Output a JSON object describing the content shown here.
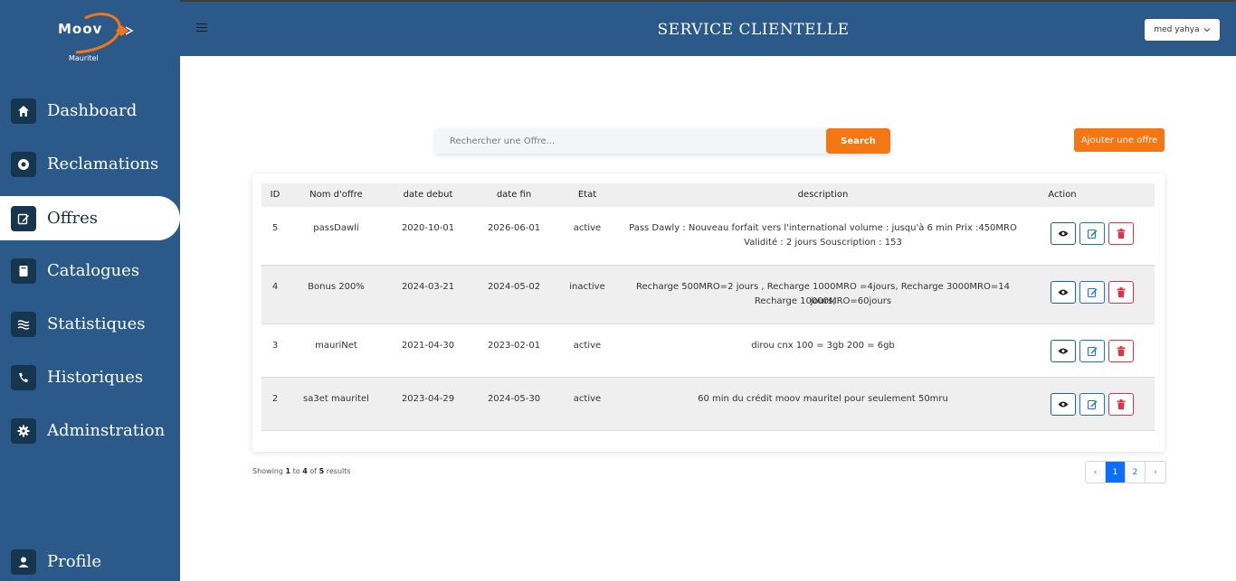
{
  "brand": {
    "name": "Moov",
    "sub": "Mauritel"
  },
  "sidebar": {
    "items": [
      {
        "label": "Dashboard",
        "icon": "home-icon"
      },
      {
        "label": "Reclamations",
        "icon": "circle-dot-icon"
      },
      {
        "label": "Offres",
        "icon": "edit-icon",
        "active": true
      },
      {
        "label": "Catalogues",
        "icon": "book-icon"
      },
      {
        "label": "Statistiques",
        "icon": "waves-icon"
      },
      {
        "label": "Historiques",
        "icon": "phone-icon"
      },
      {
        "label": "Adminstration",
        "icon": "gear-icon"
      }
    ],
    "profile": {
      "label": "Profile",
      "icon": "user-icon"
    }
  },
  "header": {
    "title": "SERVICE CLIENTELLE",
    "user": "med yahya"
  },
  "search": {
    "placeholder": "Rechercher une Offre...",
    "button": "Search"
  },
  "add_button": "Ajouter une offre",
  "table": {
    "headers": [
      "ID",
      "Nom d'offre",
      "date debut",
      "date fin",
      "Etat",
      "description",
      "Action"
    ],
    "rows": [
      {
        "id": "5",
        "name": "passDawli",
        "start": "2020-10-01",
        "end": "2026-06-01",
        "state": "active",
        "desc1": "Pass Dawly : Nouveau forfait vers l'international volume : jusqu'à 6 min Prix :450MRO",
        "desc2": "Validité : 2 jours Souscription : 153"
      },
      {
        "id": "4",
        "name": "Bonus 200%",
        "start": "2024-03-21",
        "end": "2024-05-02",
        "state": "inactive",
        "desc1": "Recharge 500MRO=2 jours , Recharge 1000MRO =4jours, Recharge 3000MRO=14 jours,",
        "desc2": "Recharge 10000MRO=60jours"
      },
      {
        "id": "3",
        "name": "mauriNet",
        "start": "2021-04-30",
        "end": "2023-02-01",
        "state": "active",
        "desc1": "dirou cnx 100 = 3gb 200 = 6gb",
        "desc2": ""
      },
      {
        "id": "2",
        "name": "sa3et mauritel",
        "start": "2023-04-29",
        "end": "2024-05-30",
        "state": "active",
        "desc1": "60 min du crédit moov mauritel pour seulement 50mru",
        "desc2": ""
      }
    ]
  },
  "footer": {
    "showing_prefix": "Showing",
    "from": "1",
    "to_word": "to",
    "to": "4",
    "of_word": "of",
    "total": "5",
    "suffix": "results"
  },
  "pagination": {
    "prev": "‹",
    "pages": [
      "1",
      "2"
    ],
    "current": "1",
    "next": "›"
  },
  "colors": {
    "sidebar": "#2b5a8a",
    "accent": "#f57714",
    "icon_bg": "#16364f",
    "primary": "#0d6efd",
    "danger": "#dc3545"
  }
}
